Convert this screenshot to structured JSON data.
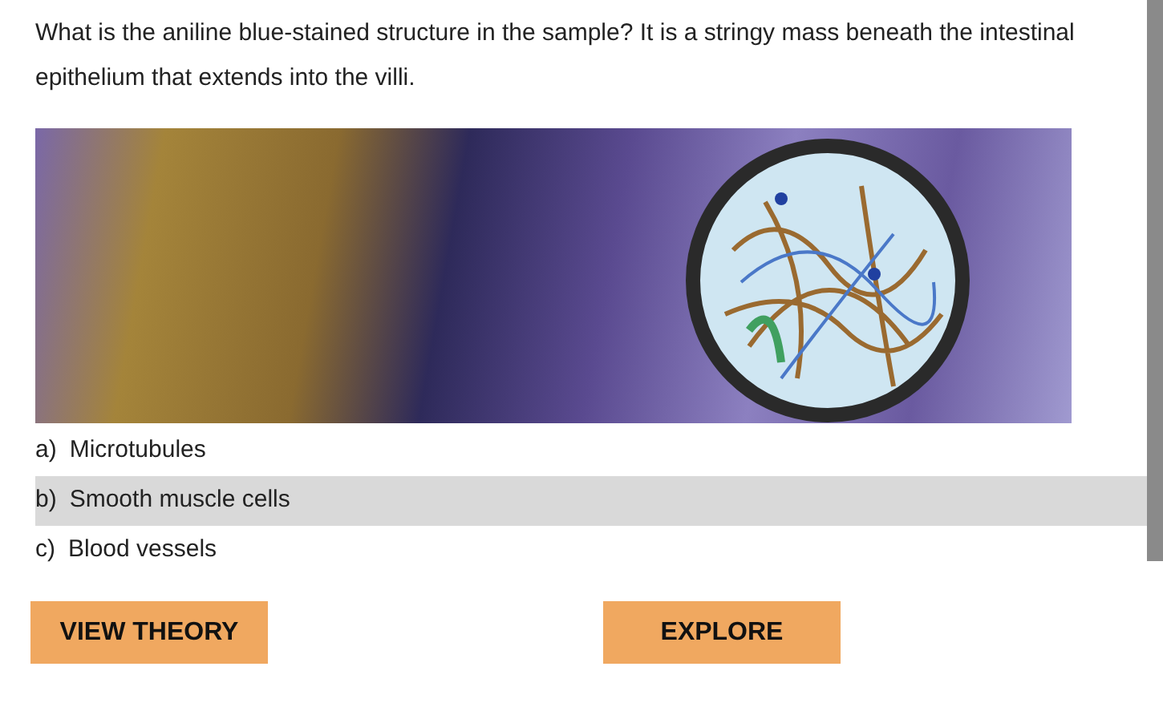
{
  "question": "What is the aniline blue-stained structure in the sample? It is a stringy mass beneath the intestinal epithelium that extends into the villi.",
  "options": [
    {
      "letter": "a)",
      "text": "Microtubules",
      "selected": false
    },
    {
      "letter": "b)",
      "text": "Smooth muscle cells",
      "selected": true
    },
    {
      "letter": "c)",
      "text": "Blood vessels",
      "selected": false
    }
  ],
  "buttons": [
    {
      "label": "VIEW THEORY"
    },
    {
      "label": "EXPLORE"
    }
  ]
}
